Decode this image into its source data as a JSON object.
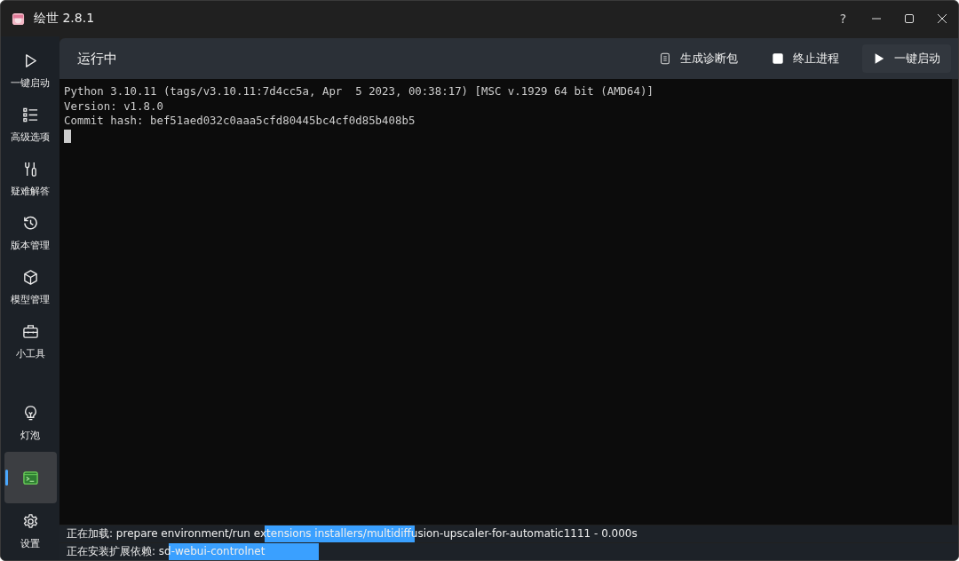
{
  "window": {
    "title": "绘世 2.8.1",
    "controls": [
      "?"
    ]
  },
  "sidebar": {
    "items": [
      {
        "kind": "play",
        "label": "一键启动",
        "selected": false
      },
      {
        "kind": "list",
        "label": "高级选项",
        "selected": false
      },
      {
        "kind": "tools",
        "label": "疑难解答",
        "selected": false
      },
      {
        "kind": "history",
        "label": "版本管理",
        "selected": false
      },
      {
        "kind": "cube",
        "label": "模型管理",
        "selected": false
      },
      {
        "kind": "toolbox",
        "label": "小工具",
        "selected": false
      }
    ],
    "bottom_items": [
      {
        "kind": "bulb",
        "label": "灯泡",
        "selected": false
      },
      {
        "kind": "terminal",
        "selected": true
      },
      {
        "kind": "gear",
        "label": "设置",
        "selected": false
      }
    ]
  },
  "header": {
    "title": "运行中",
    "actions": [
      {
        "kind": "doc",
        "label": "生成诊断包"
      },
      {
        "kind": "stop",
        "label": "终止进程"
      },
      {
        "kind": "play",
        "label": "一键启动"
      }
    ]
  },
  "console": {
    "lines": [
      "Python 3.10.11 (tags/v3.10.11:7d4cc5a, Apr  5 2023, 00:38:17) [MSC v.1929 64 bit (AMD64)]",
      "Version: v1.8.0",
      "Commit hash: bef51aed032c0aaa5cfd80445bc4cf0d85b408b5"
    ],
    "cursor": true
  },
  "status_lines": [
    {
      "text": "正在加载: prepare environment/run extensions installers/multidiffusion-upscaler-for-automatic1111 - 0.000s",
      "busy": true
    },
    {
      "text": "正在安装扩展依赖: sd-webui-controlnet",
      "busy": true
    }
  ]
}
